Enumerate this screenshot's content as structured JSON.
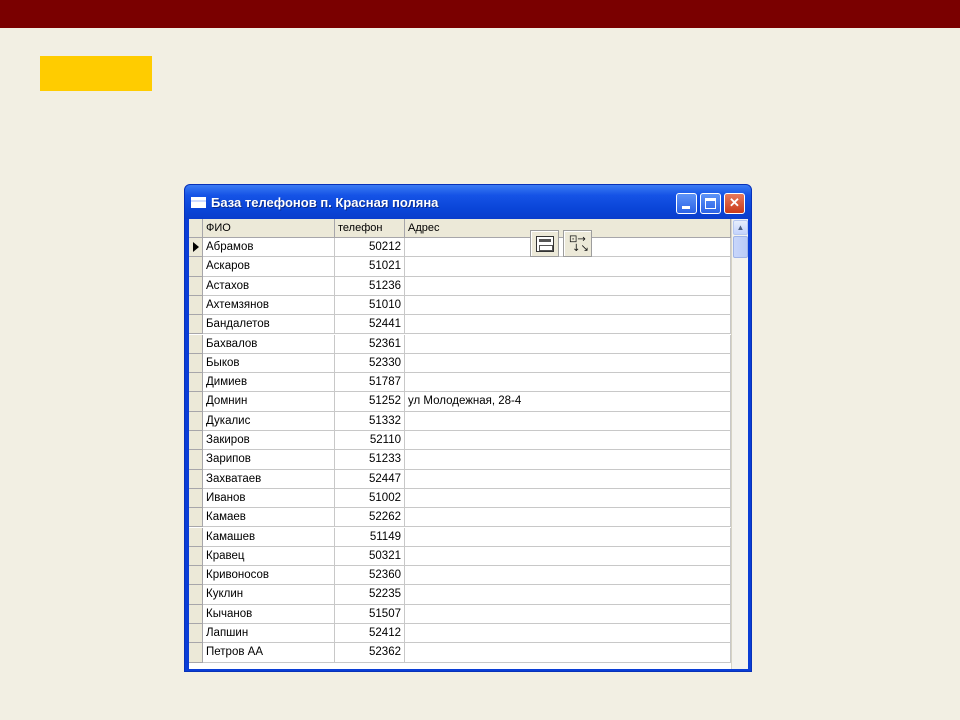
{
  "window": {
    "title": "База телефонов п. Красная поляна",
    "controls": {
      "minimize": "minimize",
      "maximize": "maximize",
      "close": "✕"
    }
  },
  "table": {
    "columns": [
      "ФИО",
      "телефон",
      "Адрес"
    ],
    "rows": [
      {
        "fio": "Абрамов",
        "tel": "50212",
        "addr": ""
      },
      {
        "fio": "Аскаров",
        "tel": "51021",
        "addr": ""
      },
      {
        "fio": "Астахов",
        "tel": "51236",
        "addr": ""
      },
      {
        "fio": "Ахтемзянов",
        "tel": "51010",
        "addr": ""
      },
      {
        "fio": "Бандалетов",
        "tel": "52441",
        "addr": ""
      },
      {
        "fio": "Бахвалов",
        "tel": "52361",
        "addr": ""
      },
      {
        "fio": "Быков",
        "tel": "52330",
        "addr": ""
      },
      {
        "fio": "Димиев",
        "tel": "51787",
        "addr": ""
      },
      {
        "fio": "Домнин",
        "tel": "51252",
        "addr": "ул Молодежная, 28-4"
      },
      {
        "fio": "Дукалис",
        "tel": "51332",
        "addr": ""
      },
      {
        "fio": "Закиров",
        "tel": "52110",
        "addr": ""
      },
      {
        "fio": "Зарипов",
        "tel": "51233",
        "addr": ""
      },
      {
        "fio": "Захватаев",
        "tel": "52447",
        "addr": ""
      },
      {
        "fio": "Иванов",
        "tel": "51002",
        "addr": ""
      },
      {
        "fio": "Камаев",
        "tel": "52262",
        "addr": ""
      },
      {
        "fio": "Камашев",
        "tel": "51149",
        "addr": ""
      },
      {
        "fio": "Кравец",
        "tel": "50321",
        "addr": ""
      },
      {
        "fio": "Кривоносов",
        "tel": "52360",
        "addr": ""
      },
      {
        "fio": "Куклин",
        "tel": "52235",
        "addr": ""
      },
      {
        "fio": "Кычанов",
        "tel": "51507",
        "addr": ""
      },
      {
        "fio": "Лапшин",
        "tel": "52412",
        "addr": ""
      },
      {
        "fio": "Петров АА",
        "tel": "52362",
        "addr": ""
      }
    ],
    "current_row": 0
  },
  "toolbar_icons": [
    "label-control-icon",
    "field-list-icon"
  ],
  "colors": {
    "top_band": "#7a0000",
    "accent_block": "#ffcc00",
    "background": "#f2efe3",
    "titlebar": "#0a45d8"
  }
}
